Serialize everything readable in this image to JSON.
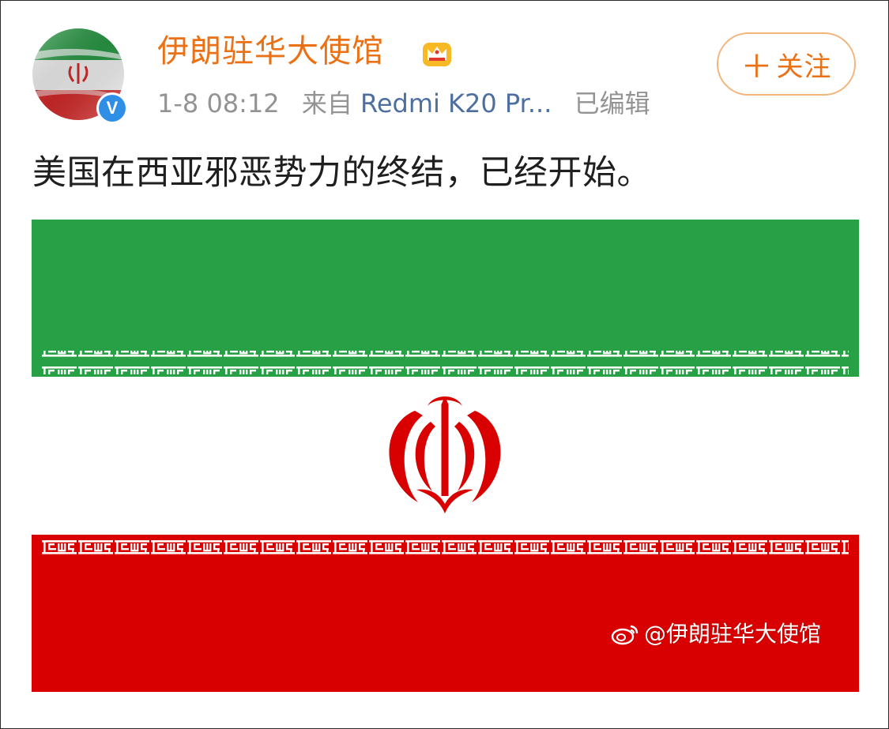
{
  "post": {
    "username": "伊朗驻华大使馆",
    "time": "1-8 08:12",
    "source_prefix": "来自",
    "source": "Redmi K20 Pr...",
    "edited": "已编辑",
    "follow_label": "关注",
    "text": "美国在西亚邪恶势力的终结，已经开始。"
  },
  "image": {
    "watermark": "@伊朗驻华大使馆"
  },
  "icons": {
    "verified": "verified-v-icon",
    "crown": "member-crown-icon",
    "weibo": "weibo-logo-icon"
  },
  "colors": {
    "username": "#eb7117",
    "link": "#4d6fa0",
    "green": "#28a045",
    "red": "#d80000",
    "verified": "#2f8ee6"
  }
}
